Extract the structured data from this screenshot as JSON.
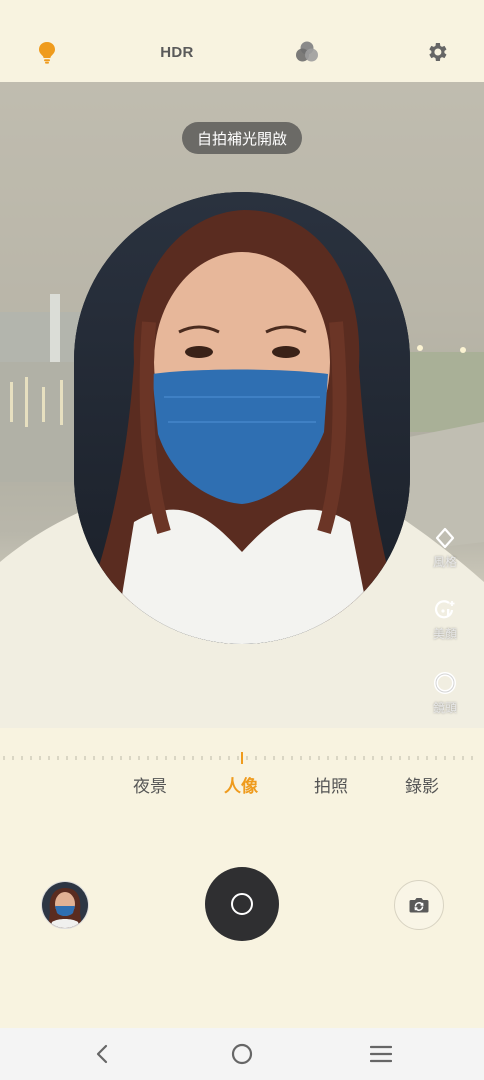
{
  "topbar": {
    "flash_icon": "lightbulb-icon",
    "hdr_label": "HDR",
    "filter_icon": "color-filter-icon",
    "settings_icon": "gear-icon"
  },
  "viewfinder": {
    "notice": "自拍補光開啟"
  },
  "side_tools": [
    {
      "icon": "sparkle-diamond-icon",
      "label": "風格"
    },
    {
      "icon": "beauty-face-icon",
      "label": "美顏"
    },
    {
      "icon": "lens-ring-icon",
      "label": "鏡頭"
    }
  ],
  "modes": [
    {
      "label": "夜景",
      "active": false
    },
    {
      "label": "人像",
      "active": true
    },
    {
      "label": "拍照",
      "active": false
    },
    {
      "label": "錄影",
      "active": false
    }
  ],
  "controls": {
    "thumbnail": "gallery-thumbnail",
    "shutter": "shutter-button",
    "flip": "switch-camera-icon"
  },
  "colors": {
    "accent": "#ef9b1d",
    "background": "#f8f3e0",
    "shutter": "#2f2f31"
  },
  "navbar": {
    "back": "back-chevron-icon",
    "home": "home-circle-icon",
    "menu": "menu-lines-icon"
  }
}
